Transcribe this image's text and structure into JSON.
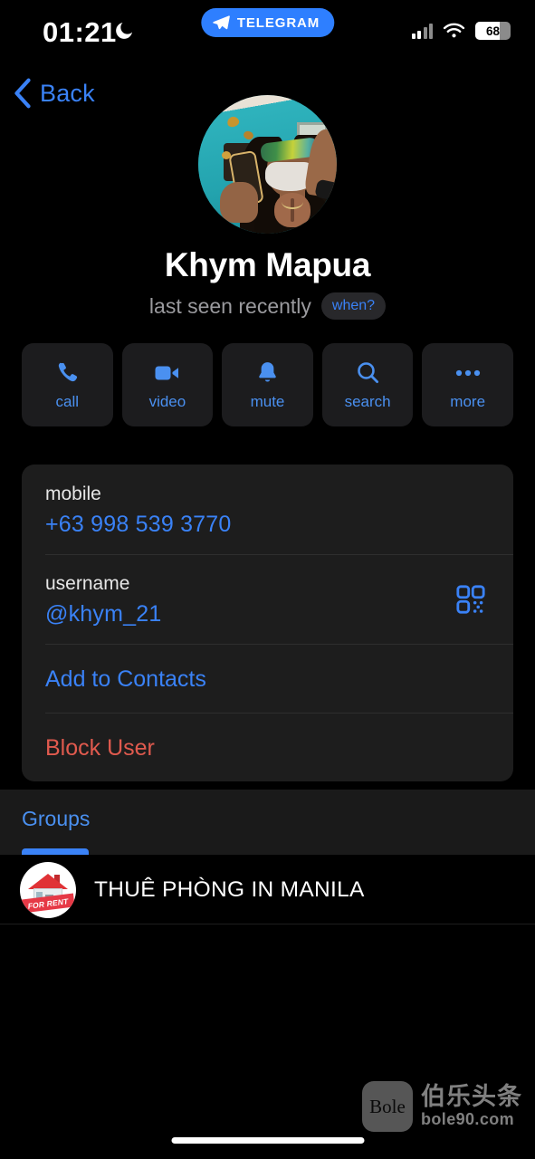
{
  "statusbar": {
    "time": "01:21",
    "dnd_icon": "moon-icon",
    "app_pill_label": "TELEGRAM",
    "app_pill_icon": "telegram-plane-icon",
    "signal_icon": "cellular-signal-icon",
    "signal_bars_filled": 2,
    "signal_bars_total": 4,
    "wifi_icon": "wifi-icon",
    "battery_percent": "68",
    "battery_level_fraction": 0.7
  },
  "nav": {
    "back_label": "Back",
    "back_icon": "chevron-left-icon"
  },
  "profile": {
    "avatar_name": "avatar",
    "name": "Khym Mapua",
    "status": "last seen recently",
    "when_badge": "when?"
  },
  "actions": [
    {
      "label": "call",
      "icon": "phone-icon"
    },
    {
      "label": "video",
      "icon": "video-camera-icon"
    },
    {
      "label": "mute",
      "icon": "bell-icon"
    },
    {
      "label": "search",
      "icon": "search-icon"
    },
    {
      "label": "more",
      "icon": "ellipsis-icon"
    }
  ],
  "info_card": {
    "mobile_label": "mobile",
    "mobile_value": "+63 998 539 3770",
    "username_label": "username",
    "username_value": "@khym_21",
    "qr_icon": "qr-code-icon",
    "add_to_contacts": "Add to Contacts",
    "block_user": "Block User"
  },
  "tabs": {
    "groups_label": "Groups"
  },
  "groups": [
    {
      "title": "THUÊ PHÒNG IN MANILA",
      "avatar_name": "group-avatar-for-rent",
      "avatar_banner_text": "FOR RENT"
    }
  ],
  "watermark": {
    "badge_text": "Bole",
    "brand_cn": "伯乐头条",
    "url": "bole90.com"
  },
  "colors": {
    "accent_blue": "#3a82f7",
    "tile_blue": "#4a90f0",
    "danger_red": "#e05a4e",
    "telegram_blue": "#2e7fff",
    "background": "#000000",
    "card_background": "#1d1d1d",
    "tile_background": "#1c1c1e"
  }
}
